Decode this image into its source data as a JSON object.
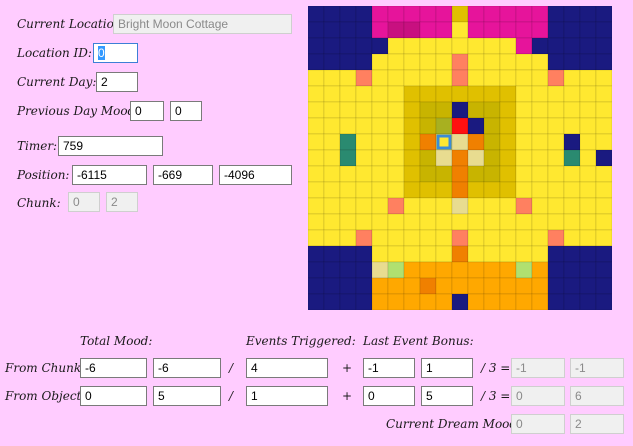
{
  "location": {
    "label": "Current Location:",
    "value": "Bright Moon Cottage"
  },
  "location_id": {
    "label": "Location ID:",
    "value": "0"
  },
  "current_day": {
    "label": "Current Day:",
    "value": "2"
  },
  "previous_mood": {
    "label": "Previous Day Mood:",
    "value_a": "0",
    "value_b": "0"
  },
  "timer": {
    "label": "Timer:",
    "value": "759"
  },
  "position": {
    "label": "Position:",
    "x": "-6115",
    "y": "-669",
    "z": "-4096"
  },
  "chunk": {
    "label": "Chunk:",
    "x": "0",
    "y": "2"
  },
  "headers": {
    "total_mood": "Total Mood:",
    "events_triggered": "Events Triggered:",
    "last_event_bonus": "Last Event Bonus:"
  },
  "operators": {
    "slash": "/",
    "plus": "+",
    "div3": "/ 3 ="
  },
  "from_chunks": {
    "label": "From Chunks:",
    "mood_a": "-6",
    "mood_b": "-6",
    "events": "4",
    "bonus_a": "-1",
    "bonus_b": "1",
    "result_a": "-1",
    "result_b": "-1"
  },
  "from_objects": {
    "label": "From Objects:",
    "mood_a": "0",
    "mood_b": "5",
    "events": "1",
    "bonus_a": "0",
    "bonus_b": "5",
    "result_a": "0",
    "result_b": "6"
  },
  "dream_mood": {
    "label": "Current Dream Mood:",
    "value_a": "0",
    "value_b": "2"
  },
  "colors": {
    "background": "#ffccff",
    "navy": "#1a1a80",
    "yellow": "#ffe830",
    "dark_yellow": "#e0c000",
    "olive": "#c8b400",
    "magenta": "#e6149b",
    "dark_magenta": "#c81080",
    "orange": "#ffa800",
    "dark_orange": "#f08000",
    "salmon": "#ff8060",
    "teal": "#2a8a70",
    "red": "#ff1010",
    "pale": "#e8dc90",
    "light_green": "#b0e070",
    "lime_olive": "#a8b020",
    "player_outline": "#3c8cd6"
  }
}
